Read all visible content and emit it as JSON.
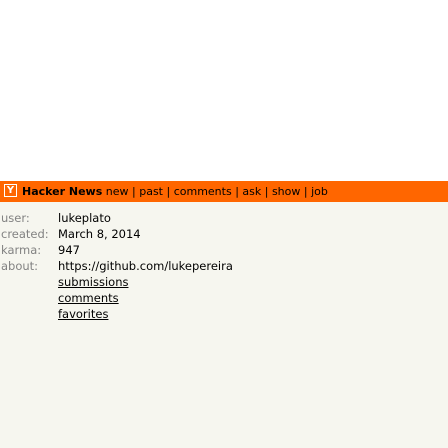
{
  "header": {
    "logo_letter": "Y",
    "site_name": "Hacker News",
    "nav": [
      "new",
      "past",
      "comments",
      "ask",
      "show",
      "job"
    ],
    "separator": " | ",
    "colors": {
      "bar": "#ff6600",
      "page_bg": "#f6f6ef"
    }
  },
  "profile": {
    "user_label": "user:",
    "user": "lukeplato",
    "created_label": "created:",
    "created": "March 8, 2014",
    "karma_label": "karma:",
    "karma": "947",
    "about_label": "about:",
    "about": "https://github.com/lukepereira",
    "links": [
      "submissions",
      "comments",
      "favorites"
    ]
  }
}
